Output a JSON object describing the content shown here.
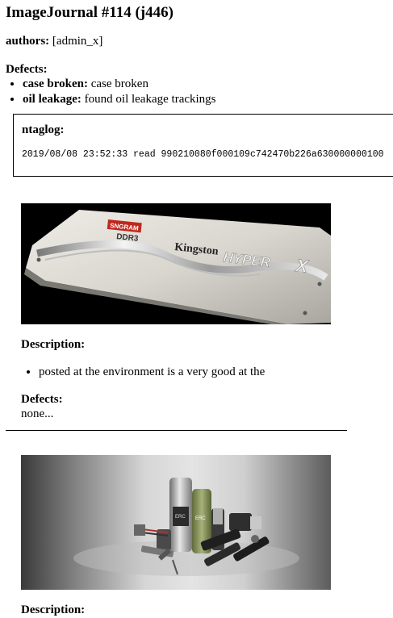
{
  "journal": {
    "title": "ImageJournal #114 (j446)",
    "authors_label": "authors:",
    "authors_value": "[admin_x]"
  },
  "defects": {
    "heading": "Defects:",
    "items": [
      {
        "label": "case broken:",
        "text": "case broken"
      },
      {
        "label": "oil leakage:",
        "text": "found oil leakage trackings"
      }
    ]
  },
  "log": {
    "title": "ntaglog:",
    "line": "2019/08/08 23:52:33 read 990210080f000109c742470b226a630000000100"
  },
  "entries": [
    {
      "image_text": {
        "brand": "Kingston",
        "product": "HYPER",
        "x_mark": "X",
        "series": "DDR3",
        "sticker": "SNGRAM"
      },
      "description_heading": "Description:",
      "description_items": [
        "posted at the environment is a very good at the"
      ],
      "defects_heading": "Defects:",
      "defects_value": "none..."
    },
    {
      "image_text": {
        "label_a": "ERC",
        "label_b": "ERC"
      },
      "description_heading": "Description:"
    }
  ],
  "colors": {
    "text": "#000000",
    "background": "#ffffff",
    "ram_body": "#d9d6cf",
    "ram_stripe": "#c9c9c9",
    "sticker_red": "#c0281f"
  }
}
